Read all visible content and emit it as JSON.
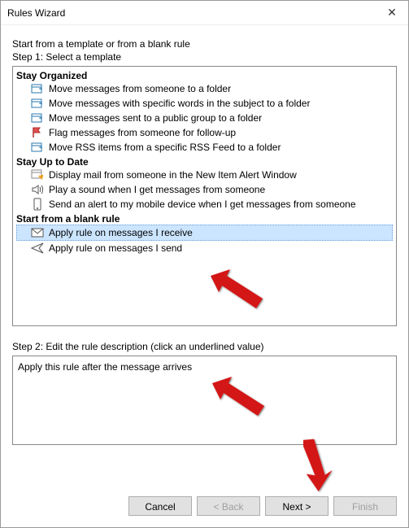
{
  "titlebar": {
    "title": "Rules Wizard"
  },
  "intro": "Start from a template or from a blank rule",
  "step1_label": "Step 1: Select a template",
  "groups": {
    "stay_organized": {
      "header": "Stay Organized",
      "items": [
        "Move messages from someone to a folder",
        "Move messages with specific words in the subject to a folder",
        "Move messages sent to a public group to a folder",
        "Flag messages from someone for follow-up",
        "Move RSS items from a specific RSS Feed to a folder"
      ]
    },
    "stay_uptodate": {
      "header": "Stay Up to Date",
      "items": [
        "Display mail from someone in the New Item Alert Window",
        "Play a sound when I get messages from someone",
        "Send an alert to my mobile device when I get messages from someone"
      ]
    },
    "blank_rule": {
      "header": "Start from a blank rule",
      "items": [
        "Apply rule on messages I receive",
        "Apply rule on messages I send"
      ]
    }
  },
  "step2_label": "Step 2: Edit the rule description (click an underlined value)",
  "description_text": "Apply this rule after the message arrives",
  "buttons": {
    "cancel": "Cancel",
    "back": "< Back",
    "next": "Next >",
    "finish": "Finish"
  },
  "colors": {
    "selection_bg": "#cce5ff",
    "arrow": "#d31616"
  }
}
